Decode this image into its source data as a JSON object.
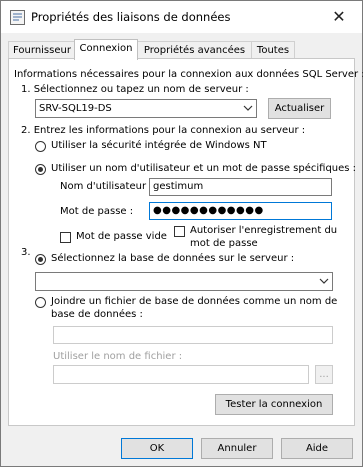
{
  "window": {
    "title": "Propriétés des liaisons de données",
    "close_glyph": "✕"
  },
  "tabs": [
    {
      "label": "Fournisseur"
    },
    {
      "label": "Connexion"
    },
    {
      "label": "Propriétés avancées"
    },
    {
      "label": "Toutes"
    }
  ],
  "connection": {
    "intro": "Informations nécessaires pour la connexion aux données SQL Server :",
    "step1_label": "1. Sélectionnez ou tapez un nom de serveur :",
    "server_value": "SRV-SQL19-DS",
    "refresh_label": "Actualiser",
    "step2_label": "2. Entrez les informations pour la connexion au serveur :",
    "auth_windows_label": "Utiliser la sécurité intégrée de Windows NT",
    "auth_sql_label": "Utiliser un nom d'utilisateur et un mot de passe spécifiques :",
    "username_label": "Nom d'utilisateur :",
    "username_value": "gestimum",
    "password_label": "Mot de passe :",
    "password_value": "●●●●●●●●●●●●",
    "blank_password_label": "Mot de passe vide",
    "save_password_label_line1": "Autoriser l'enregistrement du",
    "save_password_label_line2": "mot de passe",
    "step3_number": "3.",
    "select_db_label": "Sélectionnez la base de données sur le serveur :",
    "select_db_value": "",
    "attach_db_label_line1": "Joindre un fichier de base de données comme un nom de",
    "attach_db_label_line2": "base de données :",
    "attach_db_value": "",
    "filename_label": "Utiliser le nom de fichier :",
    "filename_value": "",
    "browse_label": "...",
    "test_label": "Tester la connexion"
  },
  "footer": {
    "ok_label": "OK",
    "cancel_label": "Annuler",
    "help_label": "Aide"
  },
  "colors": {
    "accent": "#0078d7",
    "background": "#f0f0f0",
    "panel": "#ffffff"
  }
}
